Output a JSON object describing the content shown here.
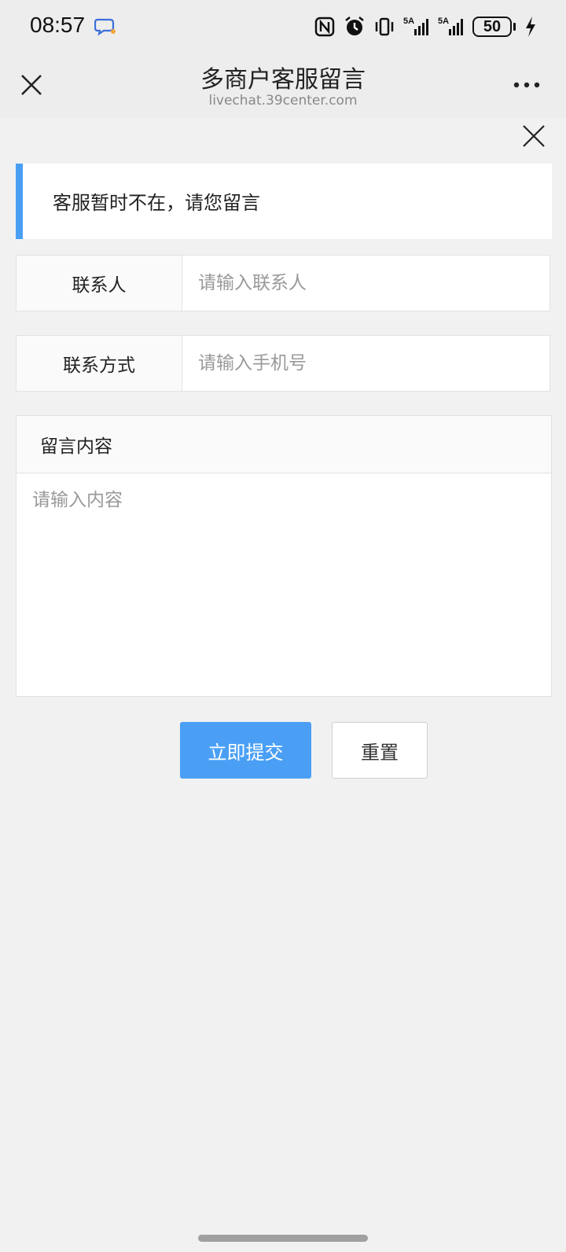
{
  "status_bar": {
    "time": "08:57",
    "battery": "50",
    "network_1": "5A",
    "network_2": "5A",
    "icons": [
      "chat-app-icon",
      "nfc-icon",
      "alarm-icon",
      "vibrate-icon",
      "signal-5g-icon",
      "signal-5g-icon",
      "battery-icon",
      "charging-icon"
    ]
  },
  "header": {
    "title": "多商户客服留言",
    "url": "livechat.39center.com",
    "close_icon": "close-icon",
    "more_icon": "more-dots-icon"
  },
  "notice": {
    "text": "客服暂时不在，请您留言",
    "accent": "#4a9ff5"
  },
  "form": {
    "contact": {
      "label": "联系人",
      "placeholder": "请输入联系人",
      "value": ""
    },
    "phone": {
      "label": "联系方式",
      "placeholder": "请输入手机号",
      "value": ""
    },
    "message": {
      "label": "留言内容",
      "placeholder": "请输入内容",
      "value": ""
    }
  },
  "buttons": {
    "submit": "立即提交",
    "reset": "重置",
    "submit_color": "#4a9ff5"
  }
}
